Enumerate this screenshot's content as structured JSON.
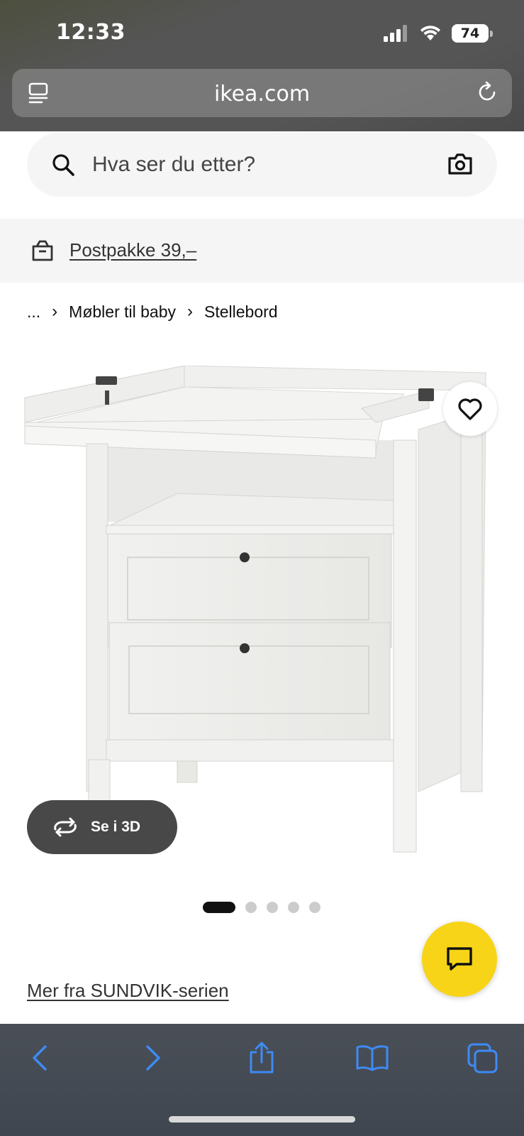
{
  "status_bar": {
    "time": "12:33",
    "battery": "74",
    "icons": [
      "signal-icon",
      "wifi-icon",
      "battery-icon"
    ]
  },
  "browser": {
    "url": "ikea.com",
    "icons": [
      "reader-icon",
      "reload-icon"
    ],
    "bottom_icons": [
      "back-icon",
      "forward-icon",
      "share-icon",
      "bookmarks-icon",
      "tabs-icon"
    ]
  },
  "search": {
    "placeholder": "Hva ser du etter?"
  },
  "banner": {
    "link": "Postpakke 39,–"
  },
  "breadcrumb": {
    "ellipsis": "...",
    "items": [
      "Møbler til baby",
      "Stellebord"
    ]
  },
  "product": {
    "view_3d_label": "Se i 3D",
    "image_count": 5,
    "active_image": 1
  },
  "series_link": "Mer fra SUNDVIK-serien",
  "colors": {
    "chat_button": "#f7d417",
    "three_d_button": "#484848",
    "ios_accent": "#3d8bf5"
  }
}
